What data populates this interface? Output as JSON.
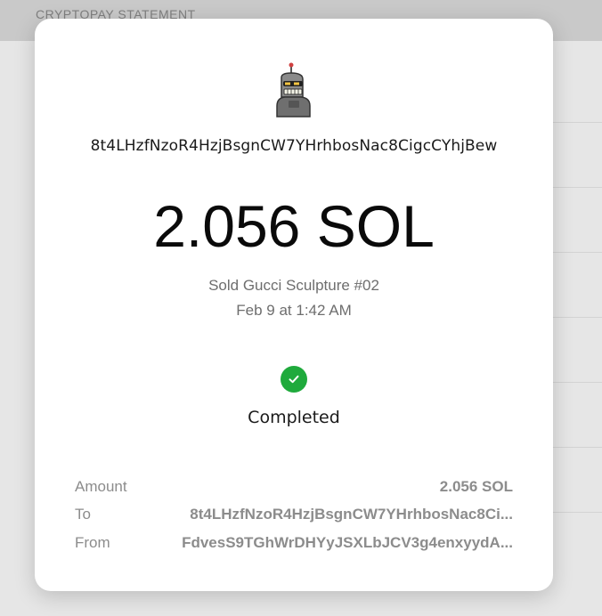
{
  "background": {
    "header_title": "CRYPTOPAY STATEMENT"
  },
  "transaction": {
    "avatar_icon": "robot-avatar-icon",
    "address": "8t4LHzfNzoR4HzjBsgnCW7YHrhbosNac8CigcCYhjBew",
    "amount": "2.056 SOL",
    "description": "Sold Gucci Sculpture #02",
    "date": "Feb 9 at 1:42 AM",
    "status_icon": "check-circle-icon",
    "status": "Completed",
    "status_color": "#1faa3c"
  },
  "details": {
    "amount_label": "Amount",
    "amount_value": "2.056 SOL",
    "to_label": "To",
    "to_value": "8t4LHzfNzoR4HzjBsgnCW7YHrhbosNac8Ci...",
    "from_label": "From",
    "from_value": "FdvesS9TGhWrDHYyJSXLbJCV3g4enxyydA..."
  }
}
